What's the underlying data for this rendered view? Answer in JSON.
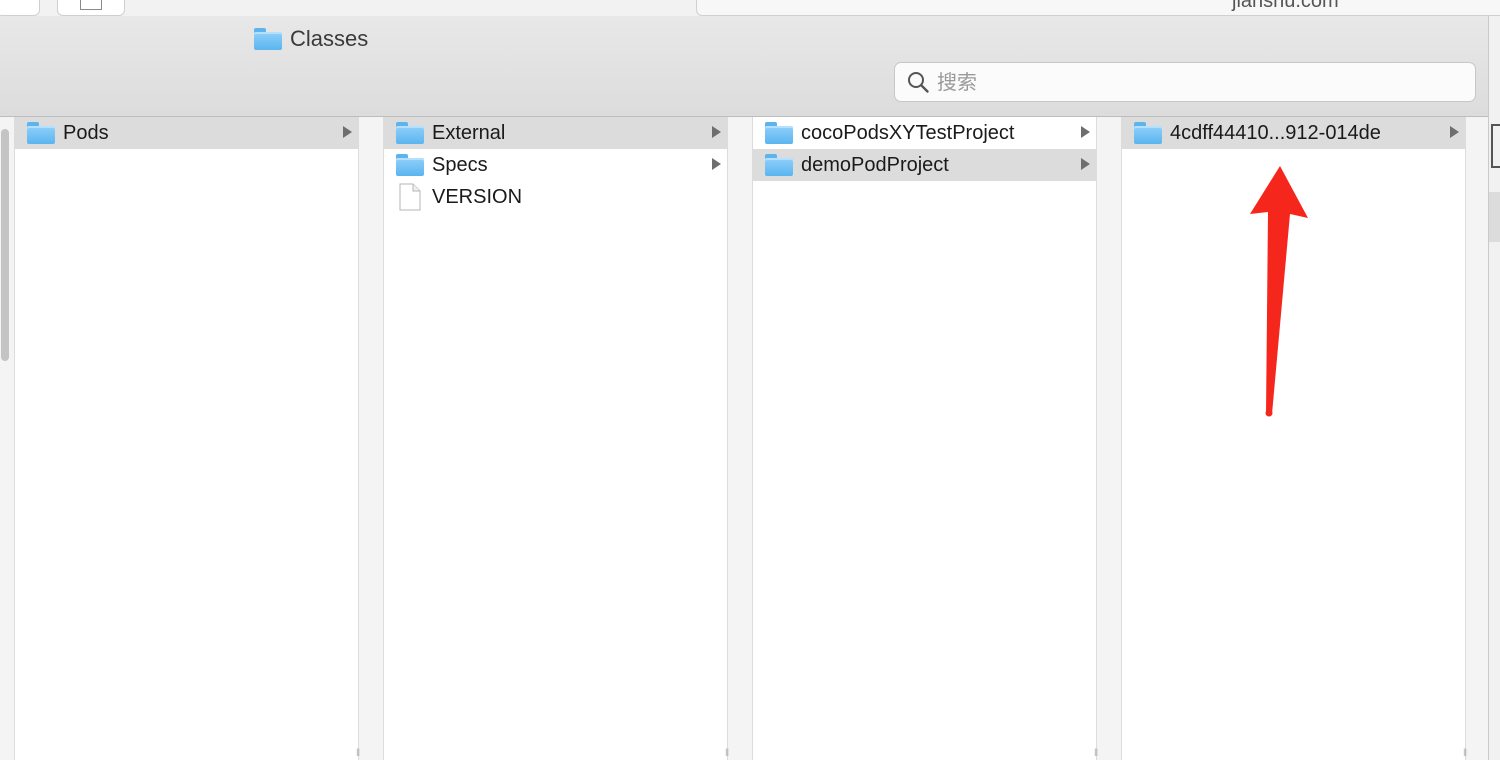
{
  "background_window": {
    "url_fragment": "jianshu.com"
  },
  "window": {
    "title": "Classes"
  },
  "search": {
    "placeholder": "搜索",
    "value": ""
  },
  "columns": [
    {
      "items": [
        {
          "label": "Pods",
          "kind": "folder",
          "selected": true,
          "expandable": true
        }
      ]
    },
    {
      "items": [
        {
          "label": "External",
          "kind": "folder",
          "selected": true,
          "expandable": true
        },
        {
          "label": "Specs",
          "kind": "folder",
          "selected": false,
          "expandable": true
        },
        {
          "label": "VERSION",
          "kind": "file",
          "selected": false,
          "expandable": false
        }
      ]
    },
    {
      "items": [
        {
          "label": "cocoPodsXYTestProject",
          "kind": "folder",
          "selected": false,
          "expandable": true
        },
        {
          "label": "demoPodProject",
          "kind": "folder",
          "selected": true,
          "expandable": true
        }
      ]
    },
    {
      "items": [
        {
          "label": "4cdff44410...912-014de",
          "kind": "folder",
          "selected": true,
          "expandable": true
        }
      ]
    }
  ],
  "colors": {
    "folder_blue": "#5ab5ef",
    "selection_gray": "#dcdcdc",
    "annotation_red": "#f5271c"
  },
  "icons": {
    "folder": "folder-icon",
    "file": "document-icon",
    "search": "magnifier-icon",
    "expand": "chevron-right-icon"
  }
}
